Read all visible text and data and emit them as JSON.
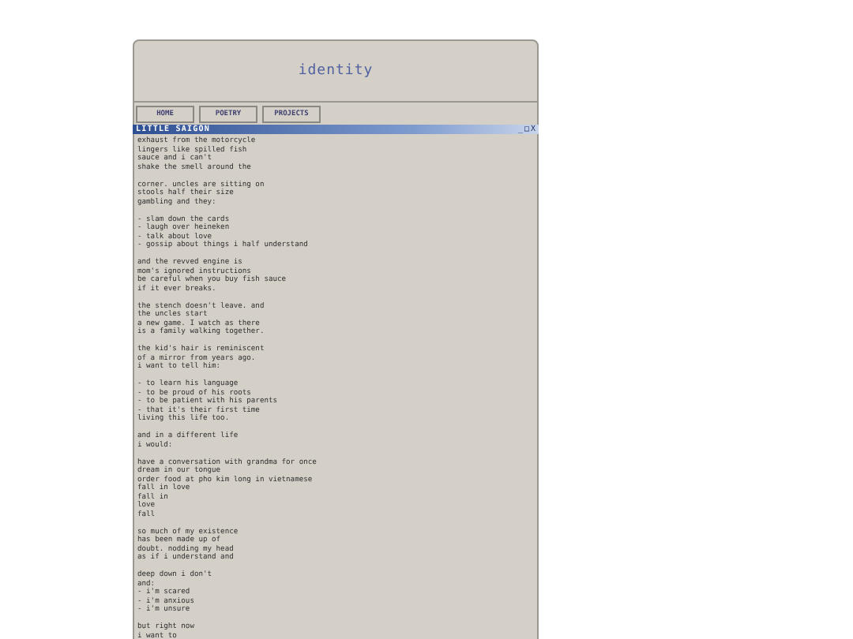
{
  "header": {
    "title": "identity"
  },
  "nav": [
    "HOME",
    "POETRY",
    "PROJECTS"
  ],
  "window": {
    "title": "LITTLE SAIGON",
    "controls": [
      "_",
      "□",
      "X"
    ]
  },
  "poem": [
    [
      "exhaust from the motorcycle",
      "lingers like spilled fish",
      "sauce and i can't",
      "shake the smell around the"
    ],
    [
      "corner. uncles are sitting on",
      "stools half their size",
      "gambling and they:"
    ],
    [
      "- slam down the cards",
      "- laugh over heineken",
      "- talk about love",
      "- gossip about things i half understand"
    ],
    [
      "and the revved engine is",
      "mom's ignored instructions",
      "be careful when you buy fish sauce",
      "if it ever breaks."
    ],
    [
      "the stench doesn't leave. and",
      "the uncles start",
      "a new game. I watch as there",
      "is a family walking together."
    ],
    [
      "the kid's hair is reminiscent",
      "of a mirror from years ago.",
      "i want to tell him:"
    ],
    [
      "- to learn his language",
      "- to be proud of his roots",
      "- to be patient with his parents",
      "- that it's their first time",
      "living this life too."
    ],
    [
      "and in a different life",
      "i would:"
    ],
    [
      "have a conversation with grandma for once",
      "dream in our tongue",
      "order food at pho kim long in vietnamese",
      "fall in love",
      "fall in",
      "love",
      "fall"
    ],
    [
      "so much of my existence",
      "has been made up of",
      "doubt. nodding my head",
      "as if i understand and"
    ],
    [
      "deep down i don't",
      "and:",
      "- i'm scared",
      "- i'm anxious",
      "- i'm unsure"
    ],
    [
      "but right now",
      "i want to"
    ]
  ]
}
